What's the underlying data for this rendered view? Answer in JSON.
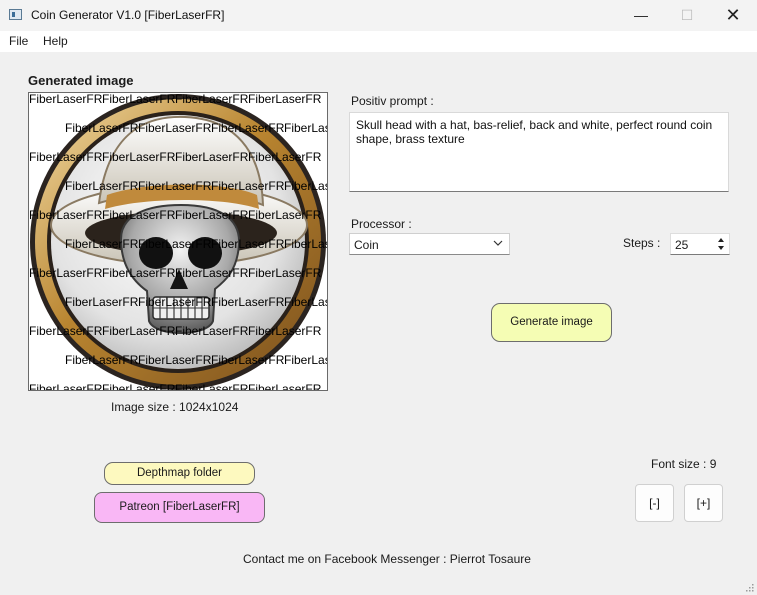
{
  "window": {
    "title": "Coin Generator V1.0 [FiberLaserFR]",
    "minimize_glyph": "—",
    "maximize_glyph": "☐",
    "close_glyph": "✕"
  },
  "menu": {
    "file": "File",
    "help": "Help"
  },
  "image_panel": {
    "label": "Generated image",
    "watermark_text": "FiberLaserFR",
    "size_text": "Image size : 1024x1024"
  },
  "prompt": {
    "label": "Positiv prompt :",
    "value": "Skull head with a hat, bas-relief, back and white, perfect round coin shape, brass texture"
  },
  "processor": {
    "label": "Processor :",
    "value": "Coin",
    "icon": "chevron-down-icon"
  },
  "steps": {
    "label": "Steps :",
    "value": "25"
  },
  "buttons": {
    "generate": "Generate image",
    "depthmap": "Depthmap folder",
    "patreon": "Patreon [FiberLaserFR]",
    "decrease_font": "[-]",
    "increase_font": "[+]"
  },
  "font_size": {
    "label": "Font size : 9"
  },
  "contact": "Contact me on Facebook Messenger : Pierrot Tosaure",
  "colors": {
    "generate_button": "#f5fdb4",
    "depthmap_button": "#fdf9bf",
    "patreon_button": "#f9b7f5",
    "coin_rim": "#c49a4c"
  }
}
